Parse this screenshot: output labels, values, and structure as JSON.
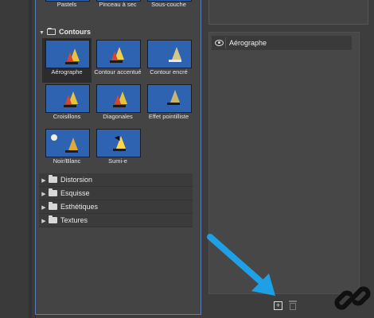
{
  "top_row": {
    "captions": [
      "Pastels",
      "Pinceau à sec",
      "Sous-couche"
    ]
  },
  "group_contours": {
    "label": "Contours",
    "expanded": true,
    "filters": [
      {
        "label": "Aérographe",
        "selected": true
      },
      {
        "label": "Contour accentué",
        "selected": false
      },
      {
        "label": "Contour encré",
        "selected": false
      },
      {
        "label": "Croisillons",
        "selected": false
      },
      {
        "label": "Diagonales",
        "selected": false
      },
      {
        "label": "Effet pointilliste",
        "selected": false
      },
      {
        "label": "Noir/Blanc",
        "selected": false
      },
      {
        "label": "Sumi-e",
        "selected": false
      }
    ]
  },
  "categories": [
    "Distorsion",
    "Esquisse",
    "Esthétiques",
    "Textures"
  ],
  "effect_layers": [
    {
      "label": "Aérographe",
      "visible": true
    }
  ],
  "colors": {
    "accent_border": "#5b7fb5",
    "annotation_arrow": "#1fa0e6"
  },
  "icons": {
    "new_layer": "new-effect-layer-icon",
    "delete_layer": "trash-icon",
    "visibility": "eye-icon",
    "watermark": "chain-link-icon"
  }
}
